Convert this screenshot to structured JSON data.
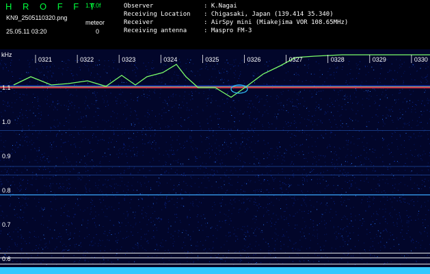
{
  "header": {
    "brand": "H R O F F T",
    "version": "1.0.0f",
    "filename": "KN9_2505110320.png",
    "datetime": "25.05.11 03:20",
    "meteor_label": "meteor",
    "meteor_count": "0",
    "meta": [
      {
        "key": "Observer",
        "value": ": K.Nagai"
      },
      {
        "key": "Receiving Location",
        "value": ": Chigasaki, Japan (139.414 35.340)"
      },
      {
        "key": "Receiver",
        "value": ": AirSpy mini (Miakejima VOR 108.65MHz)"
      },
      {
        "key": "Receiving antenna",
        "value": ": Maspro FM-3"
      }
    ]
  },
  "spectrogram": {
    "y_unit": "kHz",
    "y_ticks": [
      "1.1",
      "1.0",
      "0.9",
      "0.8",
      "0.7",
      "0.6"
    ],
    "time_ticks": [
      "0321",
      "0322",
      "0323",
      "0324",
      "0325",
      "0326",
      "0327",
      "0328",
      "0329",
      "0330"
    ],
    "colors": {
      "background": "#02062a",
      "noise": "#0b2a9a",
      "signal": "#33c8ff",
      "grid": "#e8e8e8",
      "carrier": "#ff3a3a",
      "trace": "#7cff6a"
    }
  }
}
